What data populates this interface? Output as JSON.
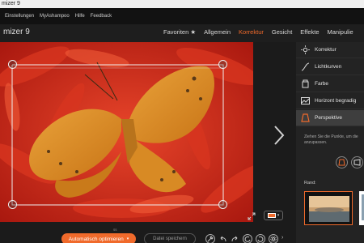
{
  "window": {
    "title": "mizer 9"
  },
  "menubar": {
    "items": [
      "Einstellungen",
      "MyAshampoo",
      "Hilfe",
      "Feedback"
    ]
  },
  "app": {
    "title": "mizer 9",
    "tabs": [
      {
        "label": "Favoriten ★",
        "active": false
      },
      {
        "label": "Allgemein",
        "active": false
      },
      {
        "label": "Korrektur",
        "active": true
      },
      {
        "label": "Gesicht",
        "active": false
      },
      {
        "label": "Effekte",
        "active": false
      },
      {
        "label": "Manipulie",
        "active": false
      }
    ]
  },
  "panel": {
    "items": [
      {
        "label": "Korrektur",
        "icon": "sun-icon",
        "active": false
      },
      {
        "label": "Lichtkurven",
        "icon": "curve-icon",
        "active": false
      },
      {
        "label": "Farbe",
        "icon": "bucket-icon",
        "active": false
      },
      {
        "label": "Horizont begradig",
        "icon": "horizon-icon",
        "active": false
      },
      {
        "label": "Perspektive",
        "icon": "perspective-icon",
        "active": true
      }
    ],
    "description": "Ziehen Sie die Punkte, um die anzupassen.",
    "rand_label": "Rand:"
  },
  "bottom": {
    "auto_label": "Automatisch optimieren",
    "save_label": "Datei speichern",
    "tiny_label": "ss"
  },
  "colors": {
    "accent": "#f06a2b",
    "background": "#1b1b1b",
    "panel": "#232323"
  }
}
